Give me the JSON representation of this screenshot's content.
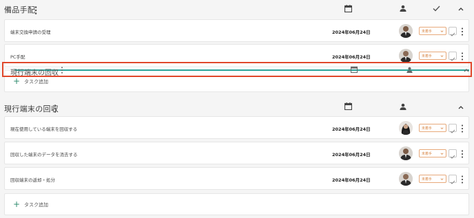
{
  "sections": [
    {
      "title": "備品手配",
      "tasks": [
        {
          "name": "端末交換申請の受理",
          "date": "2024年06月24日",
          "status": "未着手"
        },
        {
          "name": "PC手配",
          "date": "2024年06月24日",
          "status": "未着手"
        }
      ],
      "add_label": "タスク追加"
    },
    {
      "title": "現行端末の回収",
      "tasks": [
        {
          "name": "現在使用している端末を回収する",
          "date": "2024年06月24日",
          "status": "未着手"
        },
        {
          "name": "回収した端末のデータを消去する",
          "date": "2024年06月24日",
          "status": "未着手"
        },
        {
          "name": "回収端末の返却・処分",
          "date": "2024年06月24日",
          "status": "未着手"
        }
      ],
      "add_label": "タスク追加"
    }
  ],
  "drag_ghost": {
    "title": "現行端末の回収"
  },
  "colors": {
    "accent": "#2e8b6e",
    "status": "#d9894a",
    "drag_border": "#e0472a",
    "drop_line": "#2aa59a"
  },
  "icons": [
    "calendar-icon",
    "person-icon",
    "check-icon",
    "chevron-up-icon",
    "more-vert-icon",
    "add-icon"
  ]
}
